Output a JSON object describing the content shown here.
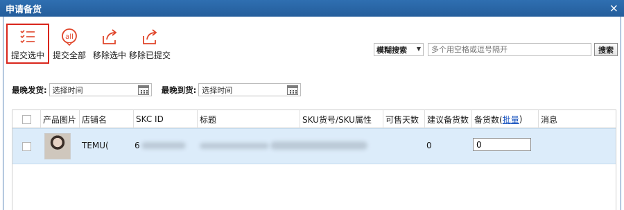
{
  "window": {
    "title": "申请备货",
    "close_glyph": "×"
  },
  "toolbar": {
    "buttons": [
      {
        "label": "提交选中",
        "icon": "list-check-icon",
        "selected": true
      },
      {
        "label": "提交全部",
        "icon": "all-badge-icon",
        "selected": false
      },
      {
        "label": "移除选中",
        "icon": "share-out-icon",
        "selected": false
      },
      {
        "label": "移除已提交",
        "icon": "share-out-icon",
        "selected": false
      }
    ]
  },
  "search": {
    "mode": "模糊搜索",
    "placeholder": "多个用空格或逗号隔开",
    "button_label": "搜索"
  },
  "filters": {
    "ship_label": "最晚发货:",
    "ship_placeholder": "选择时间",
    "arrive_label": "最晚到货:",
    "arrive_placeholder": "选择时间"
  },
  "table": {
    "columns": [
      "产品图片",
      "店铺名",
      "SKC ID",
      "标题",
      "SKU货号/SKU属性",
      "可售天数",
      "建议备货数",
      "备货数(",
      "批量",
      ")",
      "消息"
    ],
    "rows": [
      {
        "store": "TEMU(",
        "skc_id": "6",
        "title": "",
        "sku": "",
        "sellable_days": "",
        "suggested": "0",
        "stock_qty": "0",
        "message": ""
      }
    ]
  },
  "colors": {
    "accent": "#e0452a",
    "titlebar": "#2a66a6",
    "row_selected": "#dcecfa",
    "highlight_border": "#d9261c"
  }
}
